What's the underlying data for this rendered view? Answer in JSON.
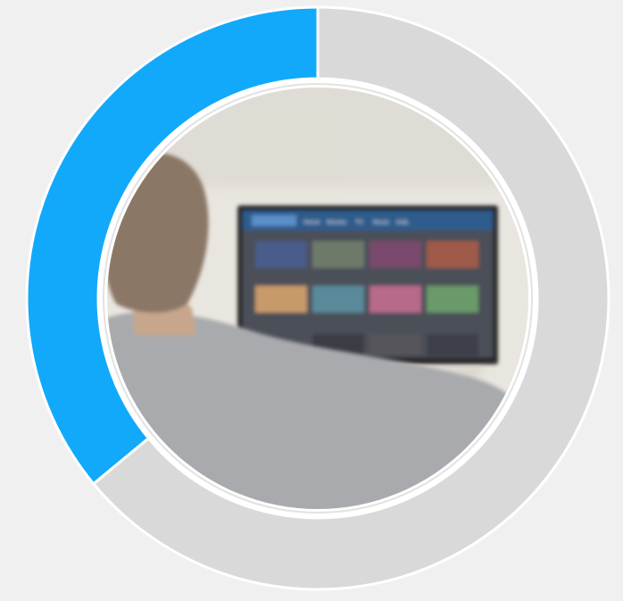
{
  "chart_data": {
    "type": "pie",
    "variant": "donut",
    "title": "",
    "labels": [],
    "values": [
      36,
      64
    ],
    "start_angle_deg": 0,
    "direction": "counterclockwise-from-top",
    "legend": "none"
  },
  "colors": {
    "page_background": "#f0f0f0",
    "accent": "#12a9fb",
    "track": "#d9d9d9",
    "separator": "#ffffff"
  },
  "center_photo": {
    "icon": "person-watching-tv-photo",
    "tv_menu_items": [
      "Home",
      "Movies",
      "TV",
      "Music",
      "Kids"
    ],
    "colors": {
      "wall": "#e9e6df",
      "sofa": "#f3f1ec",
      "sweater": "#a8aaad",
      "hair": "#8b7765",
      "skin": "#c8a68c",
      "tv_frame": "#2c2c2c",
      "tv_screen": "#4b5058",
      "tv_nav": "#2e5b8c"
    }
  }
}
